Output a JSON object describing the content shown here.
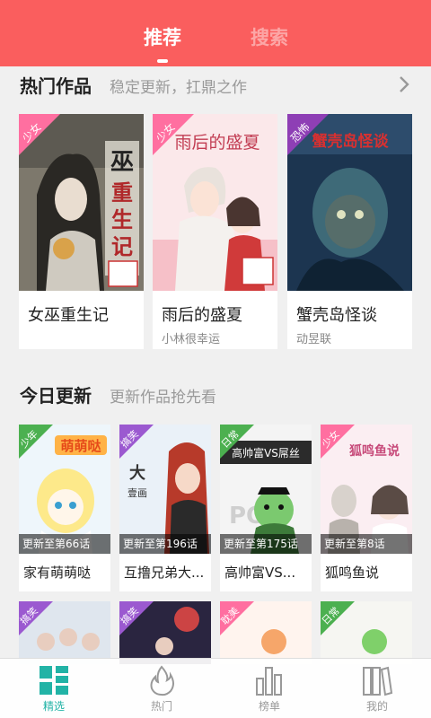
{
  "header": {
    "tabs": [
      {
        "label": "推荐",
        "active": true
      },
      {
        "label": "搜索",
        "active": false
      }
    ],
    "accent_color": "#fa5e5e"
  },
  "hot": {
    "title": "热门作品",
    "subtitle": "稳定更新，扛鼎之作",
    "items": [
      {
        "genre": "少女",
        "genre_color": "#ff6fa0",
        "title": "女巫重生记",
        "author": "",
        "cover_text": "女巫重生记"
      },
      {
        "genre": "少女",
        "genre_color": "#ff6fa0",
        "title": "雨后的盛夏",
        "author": "小林很幸运",
        "cover_text": "雨后的盛夏"
      },
      {
        "genre": "恐怖",
        "genre_color": "#8e3fb5",
        "title": "蟹壳岛怪谈",
        "author": "动昱联",
        "cover_text": "蟹壳岛怪谈"
      }
    ]
  },
  "today": {
    "title": "今日更新",
    "subtitle": "更新作品抢先看",
    "items": [
      {
        "genre": "少年",
        "genre_color": "#4cb050",
        "title": "家有萌萌哒",
        "progress": "更新至第66话",
        "cover_text": "萌萌哒"
      },
      {
        "genre": "搞笑",
        "genre_color": "#9b59d0",
        "title": "互撸兄弟大...",
        "progress": "更新至第196话",
        "cover_text": "大壹画"
      },
      {
        "genre": "日常",
        "genre_color": "#4cb050",
        "title": "高帅富VS...",
        "progress": "更新至第175话",
        "cover_text": "高帅富VS屌丝"
      },
      {
        "genre": "少女",
        "genre_color": "#ff6fa0",
        "title": "狐鸣鱼说",
        "progress": "更新至第8话",
        "cover_text": "狐鸣鱼说"
      }
    ]
  },
  "more": {
    "items": [
      {
        "genre": "搞笑",
        "genre_color": "#9b59d0"
      },
      {
        "genre": "搞笑",
        "genre_color": "#9b59d0"
      },
      {
        "genre": "耽美",
        "genre_color": "#ff6fa0"
      },
      {
        "genre": "日常",
        "genre_color": "#4cb050"
      }
    ]
  },
  "bottom_nav": {
    "items": [
      {
        "label": "精选",
        "icon": "grid-icon",
        "active": true
      },
      {
        "label": "热门",
        "icon": "flame-icon",
        "active": false
      },
      {
        "label": "榜单",
        "icon": "bar-chart-icon",
        "active": false
      },
      {
        "label": "我的",
        "icon": "bookshelf-icon",
        "active": false
      }
    ],
    "active_color": "#22b3a6",
    "inactive_color": "#999999"
  }
}
